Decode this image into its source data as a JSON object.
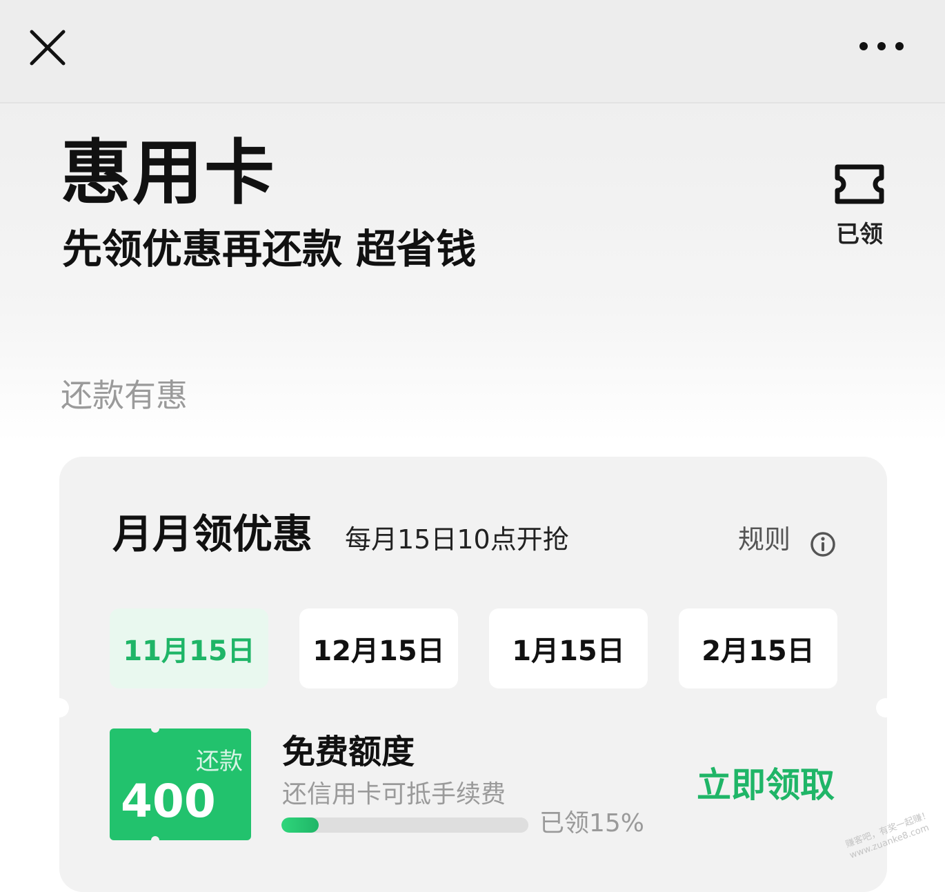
{
  "header": {
    "close_icon": "close-icon",
    "more_icon": "more-dots-icon"
  },
  "hero": {
    "title": "惠用卡",
    "subtitle": "先领优惠再还款 超省钱",
    "claimed_icon": "ticket-icon",
    "claimed_label": "已领"
  },
  "section": {
    "label": "还款有惠"
  },
  "monthly": {
    "title": "月月领优惠",
    "subtitle": "每月15日10点开抢",
    "rules_label": "规则",
    "rules_icon": "info-icon",
    "dates": [
      {
        "label": "11月15日",
        "active": true
      },
      {
        "label": "12月15日",
        "active": false
      },
      {
        "label": "1月15日",
        "active": false
      },
      {
        "label": "2月15日",
        "active": false
      }
    ]
  },
  "coupon": {
    "type_label": "还款",
    "amount": "400",
    "name": "免费额度",
    "description": "还信用卡可抵手续费",
    "progress_percent": 15,
    "progress_text": "已领15%",
    "claim_label": "立即领取"
  },
  "watermark": {
    "line1": "赚客吧，有奖一起赚！",
    "line2": "www.zuanke8.com"
  },
  "colors": {
    "accent_green": "#1fb567",
    "badge_green": "#22c26d",
    "active_tab_bg": "#e9f8ef"
  }
}
